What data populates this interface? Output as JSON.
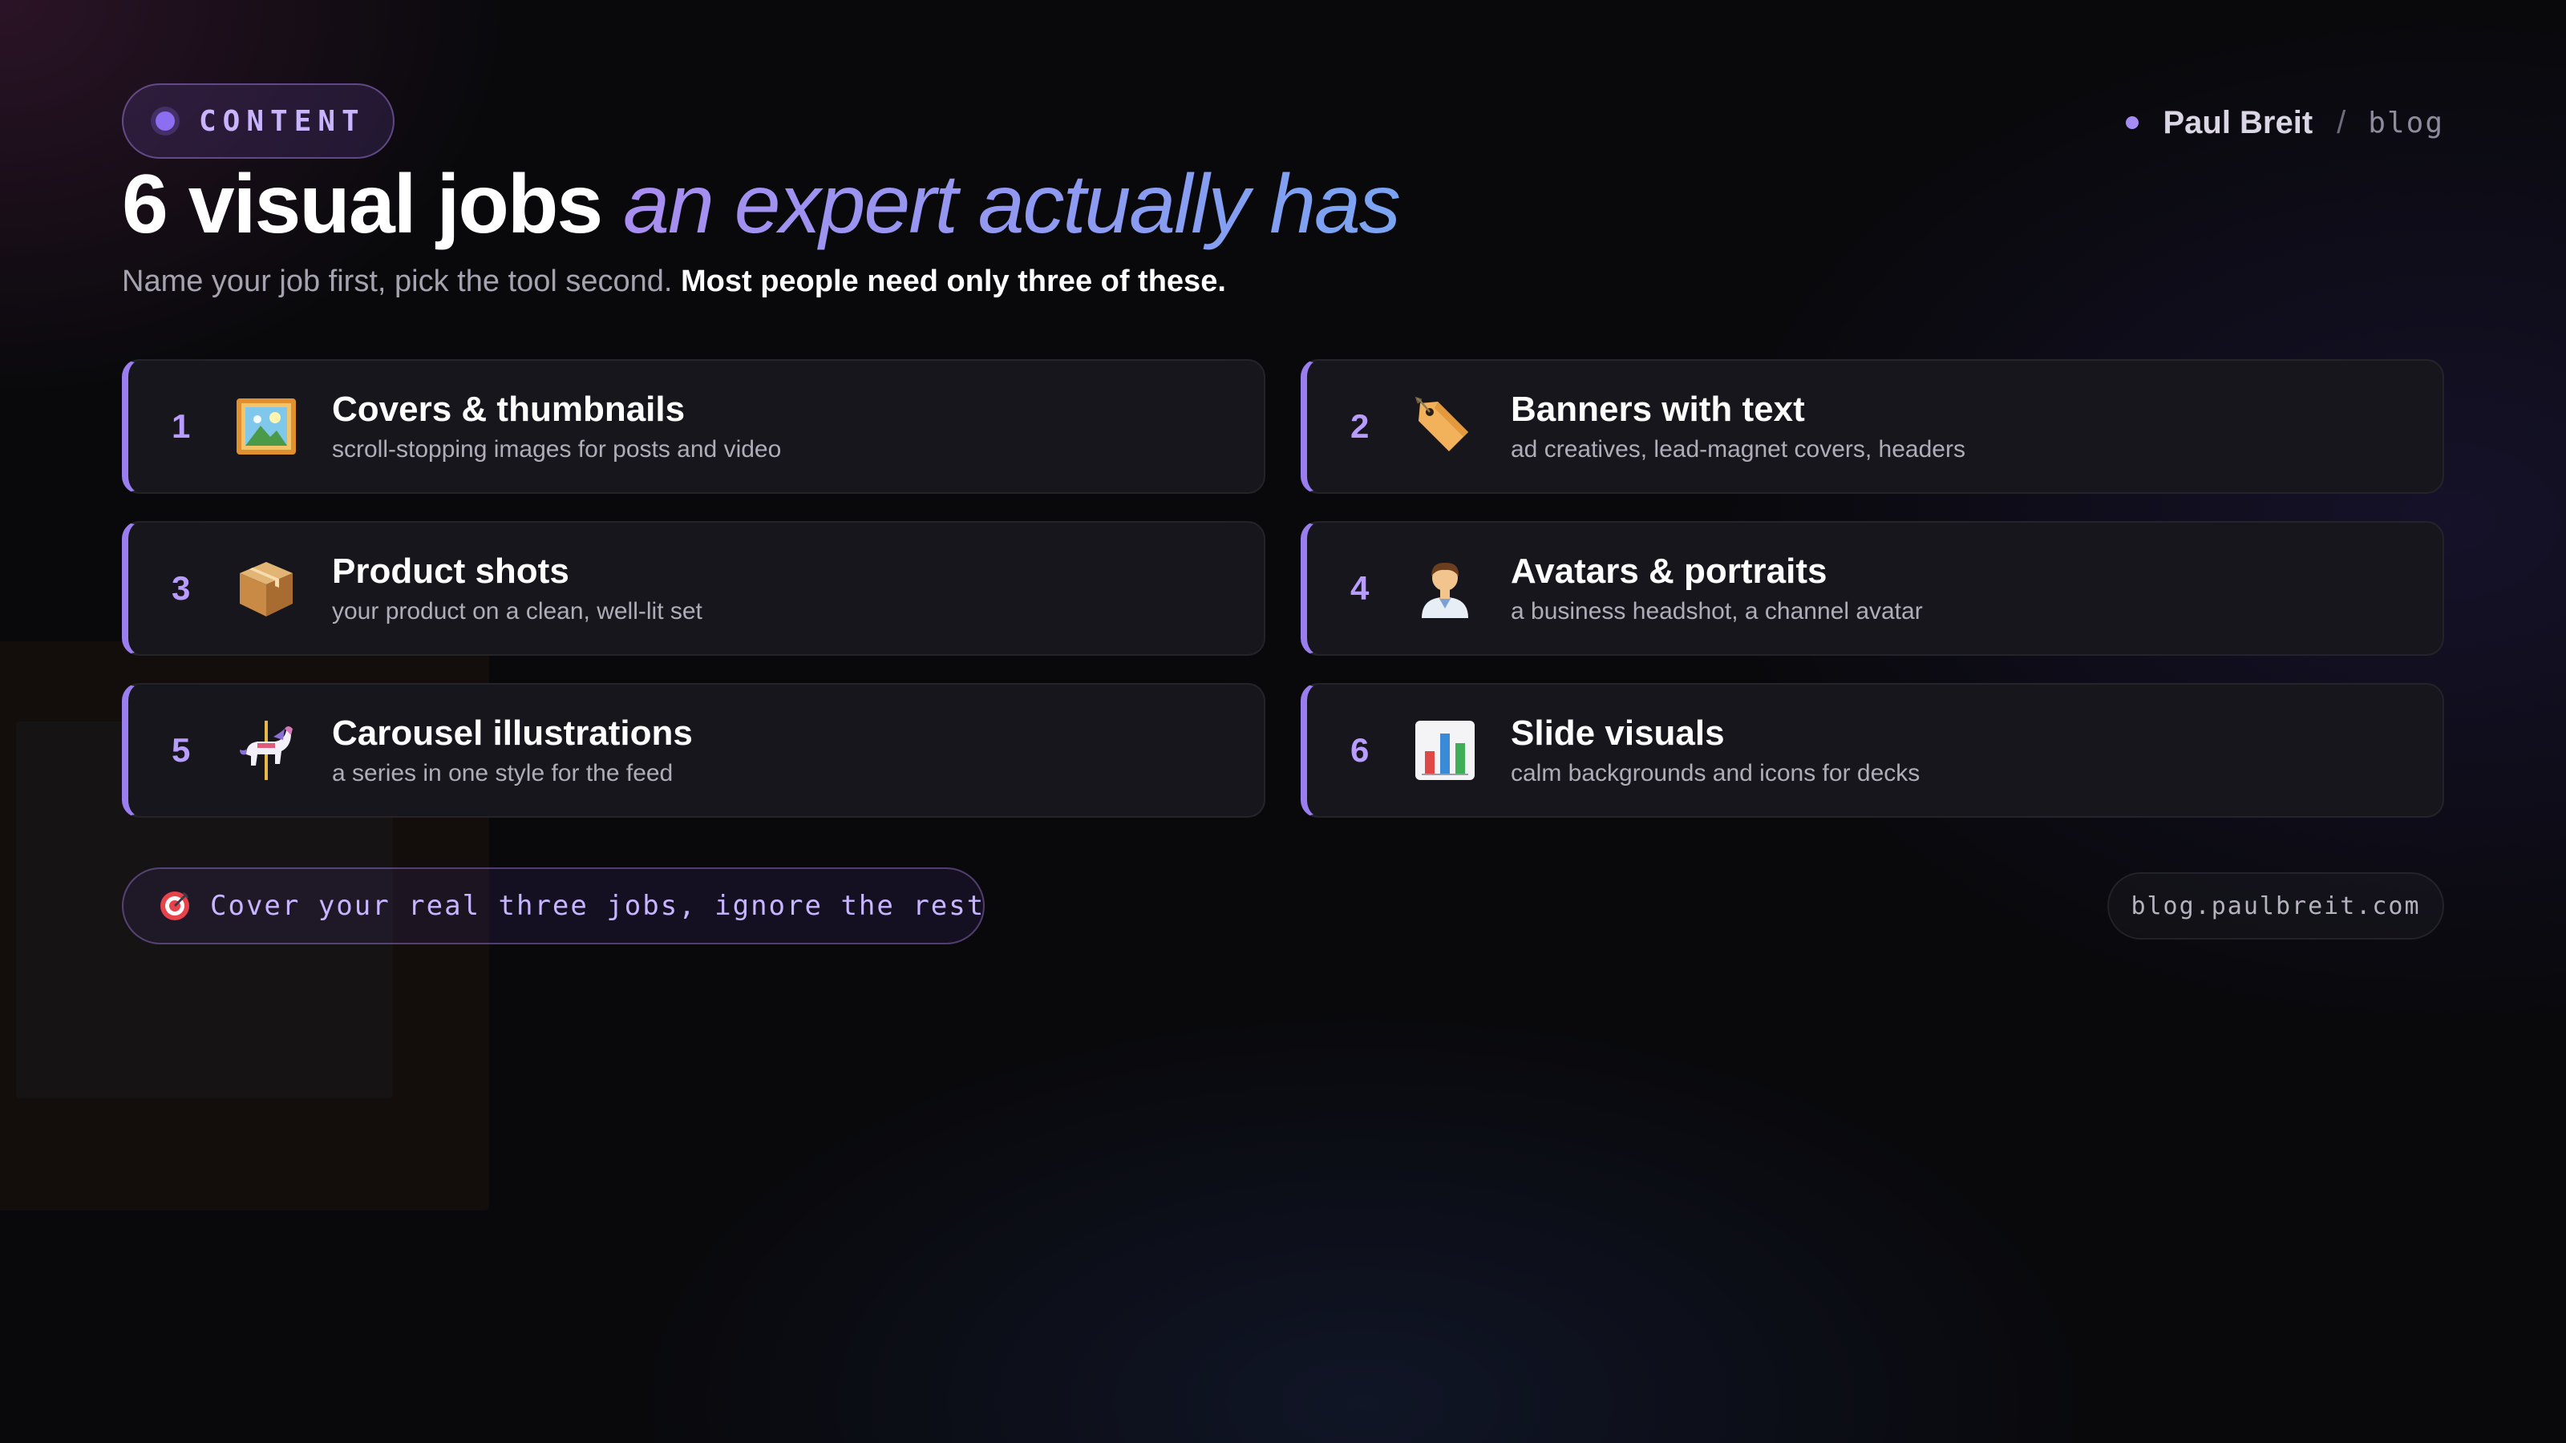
{
  "badge": {
    "label": "CONTENT"
  },
  "brand": {
    "name": "Paul Breit",
    "separator": "/",
    "section": "blog"
  },
  "header": {
    "title_main": "6 visual jobs",
    "title_accent": "an expert actually has",
    "subtitle_regular": "Name your job first, pick the tool second.",
    "subtitle_bold": "Most people need only three of these."
  },
  "jobs": [
    {
      "number": "1",
      "icon": "framed-picture-icon",
      "title": "Covers & thumbnails",
      "description": "scroll-stopping images for posts and video"
    },
    {
      "number": "2",
      "icon": "price-tag-icon",
      "title": "Banners with text",
      "description": "ad creatives, lead-magnet covers, headers"
    },
    {
      "number": "3",
      "icon": "package-box-icon",
      "title": "Product shots",
      "description": "your product on a clean, well-lit set"
    },
    {
      "number": "4",
      "icon": "person-avatar-icon",
      "title": "Avatars & portraits",
      "description": "a business headshot, a channel avatar"
    },
    {
      "number": "5",
      "icon": "carousel-horse-icon",
      "title": "Carousel illustrations",
      "description": "a series in one style for the feed"
    },
    {
      "number": "6",
      "icon": "bar-chart-icon",
      "title": "Slide visuals",
      "description": "calm backgrounds and icons for decks"
    }
  ],
  "footer": {
    "icon": "target-icon",
    "callout": "Cover your real three jobs, ignore the rest",
    "url": "blog.paulbreit.com"
  },
  "colors": {
    "accent": "#9a7ef0",
    "accent_gradient_end": "#7aa4f2",
    "background": "#09090c",
    "card": "#16161c"
  }
}
